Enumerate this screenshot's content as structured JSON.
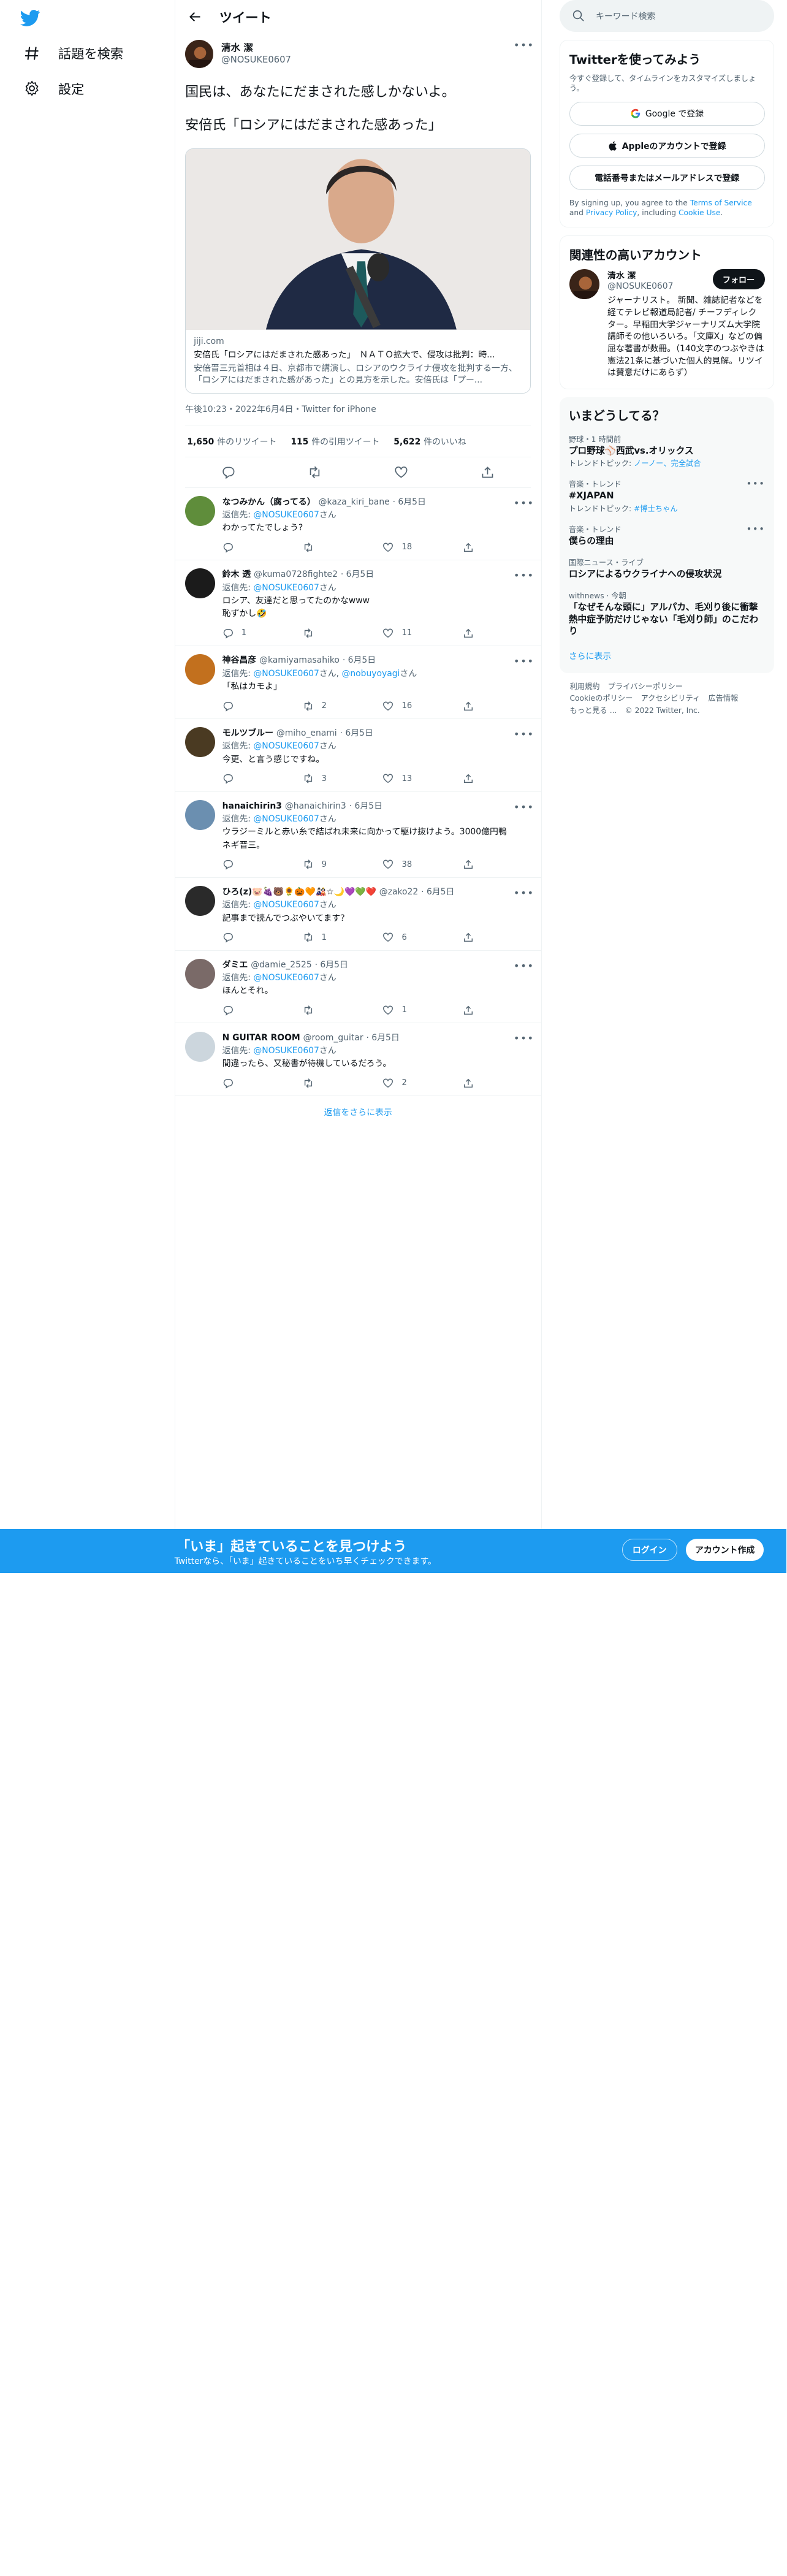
{
  "nav": {
    "explore_label": "話題を検索",
    "settings_label": "設定"
  },
  "header": {
    "title": "ツイート"
  },
  "tweet": {
    "display_name": "清水 潔",
    "handle": "@NOSUKE0607",
    "text_line1": "国民は、あなたにだまされた感しかないよ。",
    "text_line2": "安倍氏「ロシアにはだまされた感あった」",
    "card": {
      "domain": "jiji.com",
      "title": "安倍氏「ロシアにはだまされた感あった」　ＮＡＴＯ拡大で、侵攻は批判：時...",
      "description": "安倍晋三元首相は４日、京都市で講演し、ロシアのウクライナ侵攻を批判する一方、「ロシアにはだまされた感があった」との見方を示した。安倍氏は「プー..."
    },
    "meta": "午後10:23・2022年6月4日・Twitter for iPhone",
    "stats": {
      "retweets": "1,650",
      "retweets_label": "件のリツイート",
      "quotes": "115",
      "quotes_label": "件の引用ツイート",
      "likes": "5,622",
      "likes_label": "件のいいね"
    }
  },
  "replies": [
    {
      "name": "なつみかん（腐ってる）",
      "handle": "@kaza_kiri_bane",
      "date": "· 6月5日",
      "to_prefix": "返信先: ",
      "mention": "@NOSUKE0607",
      "mention2": "",
      "to_suffix": "さん",
      "text": "わかってたでしょう?",
      "text2": "",
      "reply_count": "",
      "rt_count": "",
      "like_count": "18",
      "avatar_color": "#5f8d3b"
    },
    {
      "name": "鈴木 透",
      "handle": "@kuma0728fighte2",
      "date": "· 6月5日",
      "to_prefix": "返信先: ",
      "mention": "@NOSUKE0607",
      "mention2": "",
      "to_suffix": "さん",
      "text": "ロシア、友達だと思ってたのかなwww",
      "text2": "恥ずかし🤣",
      "reply_count": "1",
      "rt_count": "",
      "like_count": "11",
      "avatar_color": "#1b1b1b"
    },
    {
      "name": "神谷昌彦",
      "handle": "@kamiyamasahiko",
      "date": "· 6月5日",
      "to_prefix": "返信先: ",
      "mention": "@NOSUKE0607",
      "mention2": "@nobuyoyagi",
      "to_suffix": "さん",
      "text": "「私はカモよ」",
      "text2": "",
      "reply_count": "",
      "rt_count": "2",
      "like_count": "16",
      "avatar_color": "#c2701e"
    },
    {
      "name": "モルツブルー",
      "handle": "@miho_enami",
      "date": "· 6月5日",
      "to_prefix": "返信先: ",
      "mention": "@NOSUKE0607",
      "mention2": "",
      "to_suffix": "さん",
      "text": "今更、と言う感じですね。",
      "text2": "",
      "reply_count": "",
      "rt_count": "3",
      "like_count": "13",
      "avatar_color": "#4a3a22"
    },
    {
      "name": "hanaichirin3",
      "handle": "@hanaichirin3",
      "date": "· 6月5日",
      "to_prefix": "返信先: ",
      "mention": "@NOSUKE0607",
      "mention2": "",
      "to_suffix": "さん",
      "text": "ウラジーミルと赤い糸で結ばれ未来に向かって駆け抜けよう。3000億円鴨",
      "text2": "ネギ晋三。",
      "reply_count": "",
      "rt_count": "9",
      "like_count": "38",
      "avatar_color": "#6b8fb0"
    },
    {
      "name": "ひろ(z)🐷🍇🐻🌻🎃🧡🎎☆🌙💜💚❤️",
      "handle": "@zako22",
      "date": "· 6月5日",
      "to_prefix": "返信先: ",
      "mention": "@NOSUKE0607",
      "mention2": "",
      "to_suffix": "さん",
      "text": "記事まで読んでつぶやいてます？",
      "text2": "",
      "reply_count": "",
      "rt_count": "1",
      "like_count": "6",
      "avatar_color": "#2a2a2a"
    },
    {
      "name": "ダミエ",
      "handle": "@damie_2525",
      "date": "· 6月5日",
      "to_prefix": "返信先: ",
      "mention": "@NOSUKE0607",
      "mention2": "",
      "to_suffix": "さん",
      "text": "ほんとそれ。",
      "text2": "",
      "reply_count": "",
      "rt_count": "",
      "like_count": "1",
      "avatar_color": "#7a6a68"
    },
    {
      "name": "N GUITAR ROOM",
      "handle": "@room_guitar",
      "date": "· 6月5日",
      "to_prefix": "返信先: ",
      "mention": "@NOSUKE0607",
      "mention2": "",
      "to_suffix": "さん",
      "text": "間違ったら、又秘書が待機しているだろう。",
      "text2": "",
      "reply_count": "",
      "rt_count": "",
      "like_count": "2",
      "avatar_color": "#ccd6dd"
    }
  ],
  "show_more_replies": "返信をさらに表示",
  "search": {
    "placeholder": "キーワード検索"
  },
  "signup_panel": {
    "title": "Twitterを使ってみよう",
    "subtitle": "今すぐ登録して、タイムラインをカスタマイズしましょう。",
    "google": "Google で登録",
    "apple": "Appleのアカウントで登録",
    "phone": "電話番号またはメールアドレスで登録",
    "terms_a": "By signing up, you agree to the ",
    "terms_link": "Terms of Service",
    "terms_b": " and ",
    "privacy_link": "Privacy Policy",
    "terms_c": ", including ",
    "cookie_link": "Cookie Use",
    "terms_d": "."
  },
  "related": {
    "title": "関連性の高いアカウント",
    "name": "清水 潔",
    "handle": "@NOSUKE0607",
    "follow": "フォロー",
    "bio": "ジャーナリスト。 新聞、雑誌記者などを経てテレビ報道局記者/ チーフディレクター。早稲田大学ジャーナリズム大学院講師その他いろいろ。「文庫X」などの偏屈な著書が数冊。（140文字のつぶやきは憲法21条に基づいた個人的見解。リツイは賛意だけにあらず）"
  },
  "trends": {
    "title": "いまどうしてる？",
    "items": [
      {
        "ctx": "野球・1 時間前",
        "name": "プロ野球⚾西武vs.オリックス",
        "sub_prefix": "トレンドトピック: ",
        "sub_link": "ノーノー、完全試合",
        "dots": false
      },
      {
        "ctx": "音楽・トレンド",
        "name": "#XJAPAN",
        "sub_prefix": "トレンドトピック: ",
        "sub_link": "#博士ちゃん",
        "dots": true
      },
      {
        "ctx": "音楽・トレンド",
        "name": "僕らの理由",
        "sub_prefix": "",
        "sub_link": "",
        "dots": true
      },
      {
        "ctx": "国際ニュース・ライブ",
        "name": "ロシアによるウクライナへの侵攻状況",
        "sub_prefix": "",
        "sub_link": "",
        "dots": false
      },
      {
        "ctx": "withnews · 今朝",
        "name": "「なぜそんな頭に」アルパカ、毛刈り後に衝撃　熱中症予防だけじゃない「毛刈り師」のこだわり",
        "sub_prefix": "",
        "sub_link": "",
        "dots": false
      }
    ],
    "show_more": "さらに表示"
  },
  "footer": {
    "terms": "利用規約",
    "privacy": "プライバシーポリシー",
    "cookie": "Cookieのポリシー",
    "accessibility": "アクセシビリティ",
    "ads": "広告情報",
    "more": "もっと見る ...",
    "copyright": "© 2022 Twitter, Inc."
  },
  "bottom_bar": {
    "title": "「いま」起きていることを見つけよう",
    "subtitle": "Twitterなら、「いま」起きていることをいち早くチェックできます。",
    "login": "ログイン",
    "signup": "アカウント作成"
  },
  "colors": {
    "accent": "#1d9bf0",
    "text": "#0f1419",
    "muted": "#536471"
  }
}
